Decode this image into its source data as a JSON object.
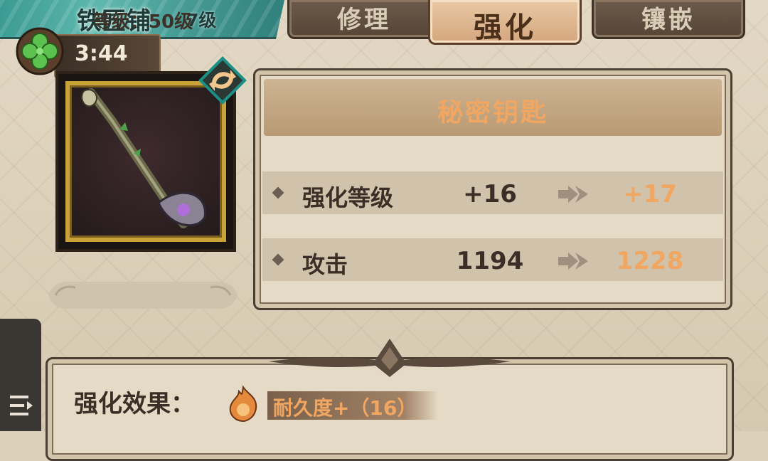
{
  "header": {
    "shop_name": "铁匠铺",
    "shop_level": "7级",
    "timer": "3:44"
  },
  "tabs": [
    {
      "label": "修理",
      "active": false
    },
    {
      "label": "强化",
      "active": true
    },
    {
      "label": "镶嵌",
      "active": false
    }
  ],
  "item": {
    "name": "秘密钥匙",
    "level_label": "等级：50级"
  },
  "stats": [
    {
      "name": "强化等级",
      "current": "+16",
      "next": "+17"
    },
    {
      "name": "攻击",
      "current": "1194",
      "next": "1228"
    }
  ],
  "effects": {
    "title": "强化效果：",
    "items": [
      {
        "label": "耐久度+（16）"
      }
    ]
  },
  "colors": {
    "accent_orange": "#f1a661",
    "banner_teal": "#4a9e98",
    "frame_gold": "#c9a339"
  },
  "icons": [
    "clover-icon",
    "swap-icon",
    "fire-orb-icon",
    "list-menu-icon"
  ]
}
